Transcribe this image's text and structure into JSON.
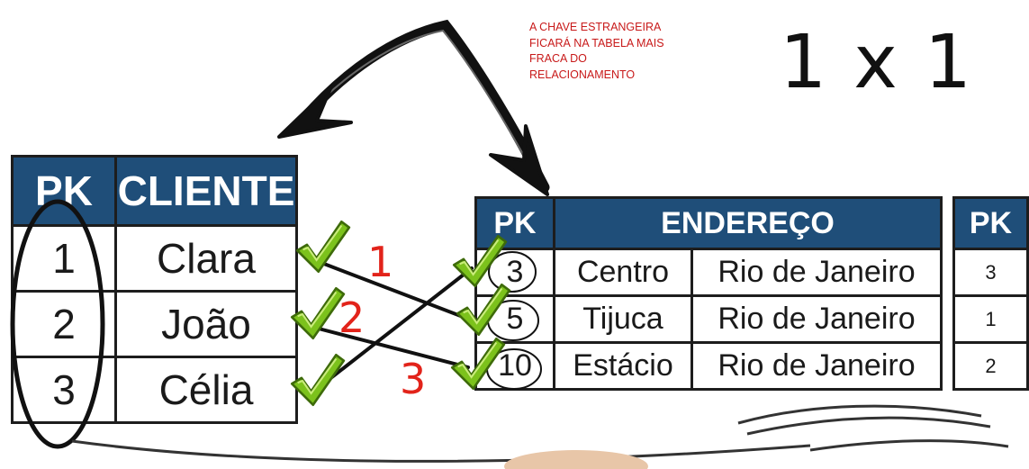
{
  "note": "A CHAVE ESTRANGEIRA FICARÁ NA TABELA MAIS FRACA DO RELACIONAMENTO",
  "ratio": "1 x 1",
  "cliente_table": {
    "headers": [
      "PK",
      "CLIENTE"
    ],
    "rows": [
      {
        "pk": "1",
        "name": "Clara"
      },
      {
        "pk": "2",
        "name": "João"
      },
      {
        "pk": "3",
        "name": "Célia"
      }
    ]
  },
  "endereco_table": {
    "headers": [
      "PK",
      "ENDEREÇO"
    ],
    "rows": [
      {
        "pk": "3",
        "bairro": "Centro",
        "cidade": "Rio de Janeiro"
      },
      {
        "pk": "5",
        "bairro": "Tijuca",
        "cidade": "Rio de Janeiro"
      },
      {
        "pk": "10",
        "bairro": "Estácio",
        "cidade": "Rio de Janeiro"
      }
    ]
  },
  "fk_table": {
    "header": "PK",
    "values": [
      "3",
      "1",
      "2"
    ]
  },
  "link_numbers": [
    "1",
    "2",
    "3"
  ],
  "colors": {
    "header_bg": "#1f4e79",
    "note_red": "#c81a1a",
    "number_red": "#e2231a",
    "check_green": "#7cc21c"
  }
}
